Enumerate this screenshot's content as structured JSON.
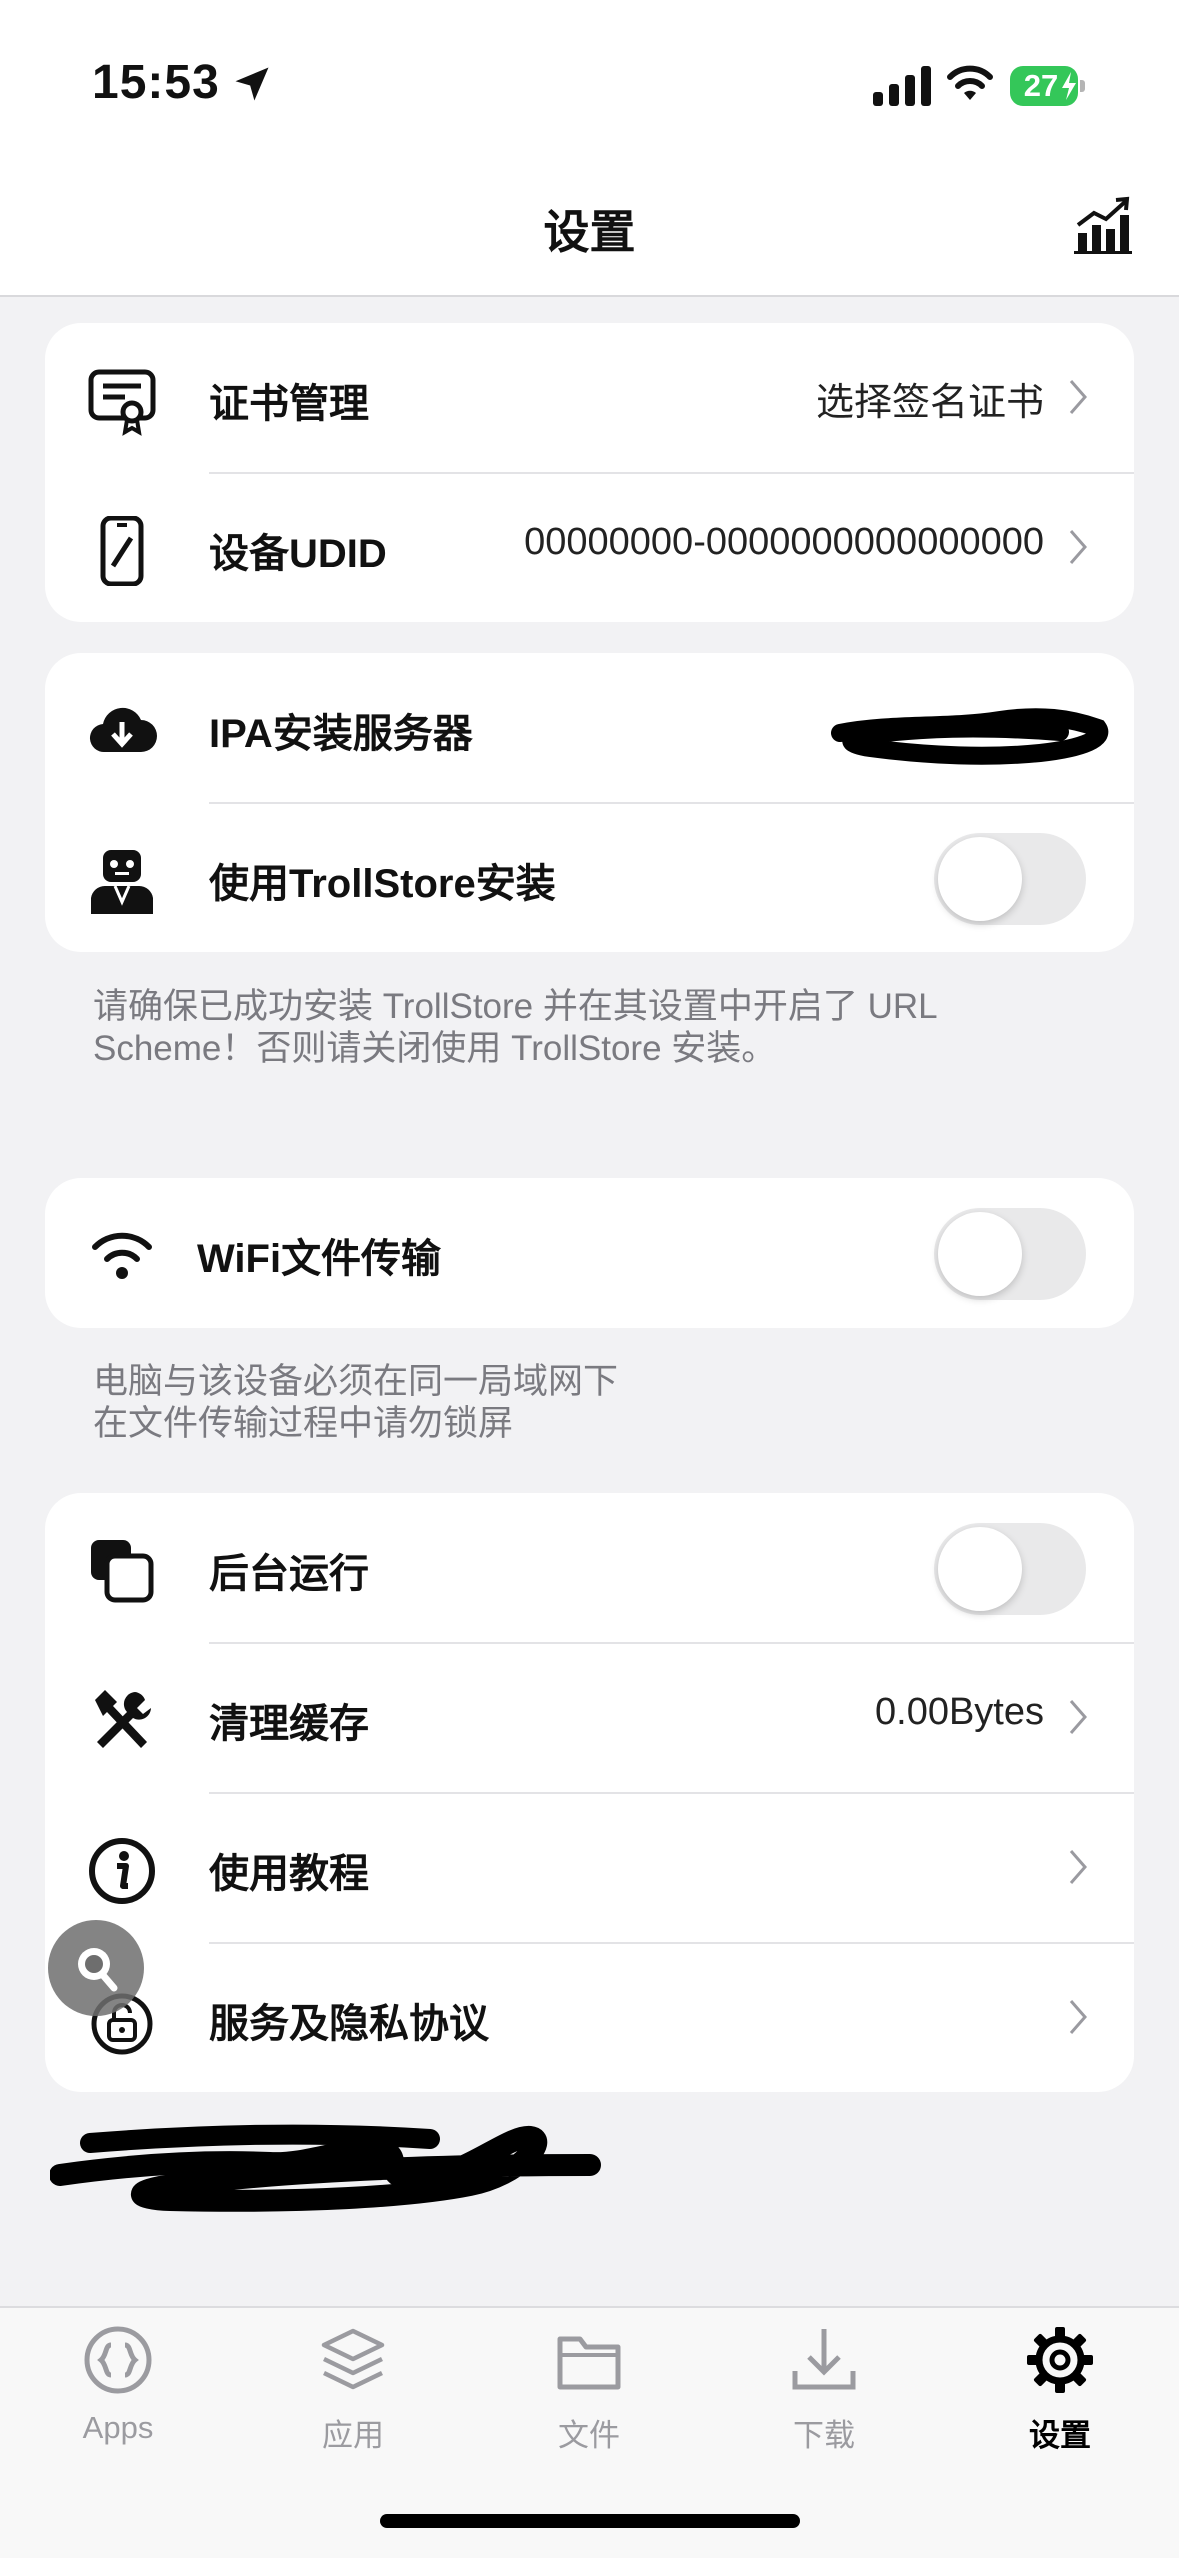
{
  "status_bar": {
    "time": "15:53",
    "battery": "27",
    "icons": [
      "location-arrow-icon",
      "cellular-signal-icon",
      "wifi-icon",
      "battery-charging-icon"
    ]
  },
  "header": {
    "title": "设置",
    "right_icon": "stats-chart-icon"
  },
  "section1": [
    {
      "label": "证书管理",
      "value": "选择签名证书",
      "icon": "certificate-icon"
    },
    {
      "label": "设备UDID",
      "value": "00000000-0000000000000000",
      "icon": "phone-icon"
    }
  ],
  "section2": [
    {
      "label": "IPA安装服务器",
      "value": "",
      "icon": "cloud-download-icon"
    },
    {
      "label": "使用TrollStore安装",
      "toggle": false,
      "icon": "robot-icon"
    }
  ],
  "section2_note": {
    "line1": "请确保已成功安装 TrollStore 并在其设置中开启了 URL",
    "line2": "Scheme！否则请关闭使用 TrollStore 安装。"
  },
  "section3": [
    {
      "label": "WiFi文件传输",
      "toggle": false,
      "icon": "wifi-icon"
    }
  ],
  "section3_note": {
    "line1": "电脑与该设备必须在同一局域网下",
    "line2": "在文件传输过程中请勿锁屏"
  },
  "section4": [
    {
      "label": "后台运行",
      "toggle": false,
      "icon": "copy-squares-icon"
    },
    {
      "label": "清理缓存",
      "value": "0.00Bytes",
      "icon": "tools-icon"
    },
    {
      "label": "使用教程",
      "icon": "info-icon"
    },
    {
      "label": "服务及隐私协议",
      "icon": "lock-icon"
    }
  ],
  "tabs": [
    {
      "label": "Apps",
      "icon": "braces-circle-icon",
      "active": false
    },
    {
      "label": "应用",
      "icon": "layers-icon",
      "active": false
    },
    {
      "label": "文件",
      "icon": "folder-icon",
      "active": false
    },
    {
      "label": "下载",
      "icon": "download-icon",
      "active": false
    },
    {
      "label": "设置",
      "icon": "gear-icon",
      "active": true
    }
  ],
  "colors": {
    "battery": "#34c759",
    "background": "#f2f2f4",
    "card": "#ffffff",
    "toggle_off": "#e9e9ea"
  }
}
